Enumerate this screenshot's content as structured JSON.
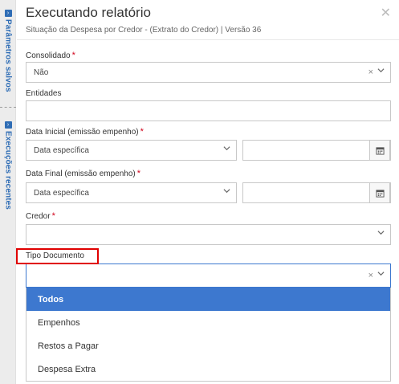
{
  "sidebar": {
    "saved_params_label": "Parâmetros salvos",
    "recent_runs_label": "Execuções recentes"
  },
  "header": {
    "title": "Executando relatório",
    "subtitle": "Situação da Despesa por Credor - (Extrato do Credor) | Versão 36",
    "close_symbol": "✕"
  },
  "form": {
    "consolidado": {
      "label": "Consolidado",
      "required_mark": "*",
      "value": "Não"
    },
    "entidades": {
      "label": "Entidades",
      "value": ""
    },
    "data_inicial": {
      "label": "Data Inicial (emissão empenho)",
      "required_mark": "*",
      "mode": "Data específica",
      "date_value": ""
    },
    "data_final": {
      "label": "Data Final (emissão empenho)",
      "required_mark": "*",
      "mode": "Data específica",
      "date_value": ""
    },
    "credor": {
      "label": "Credor",
      "required_mark": "*",
      "value": ""
    },
    "tipo_documento": {
      "label": "Tipo Documento",
      "value": "",
      "options": [
        "Todos",
        "Empenhos",
        "Restos a Pagar",
        "Despesa Extra"
      ],
      "highlighted_option": "Todos"
    }
  },
  "colors": {
    "accent": "#3d78cf",
    "sidebar_text": "#2f6db5",
    "required": "#d0021b",
    "highlight_box": "#e00000"
  },
  "icons": {
    "clear": "×",
    "chevron": "chevron-down-icon",
    "calendar": "calendar-icon"
  }
}
